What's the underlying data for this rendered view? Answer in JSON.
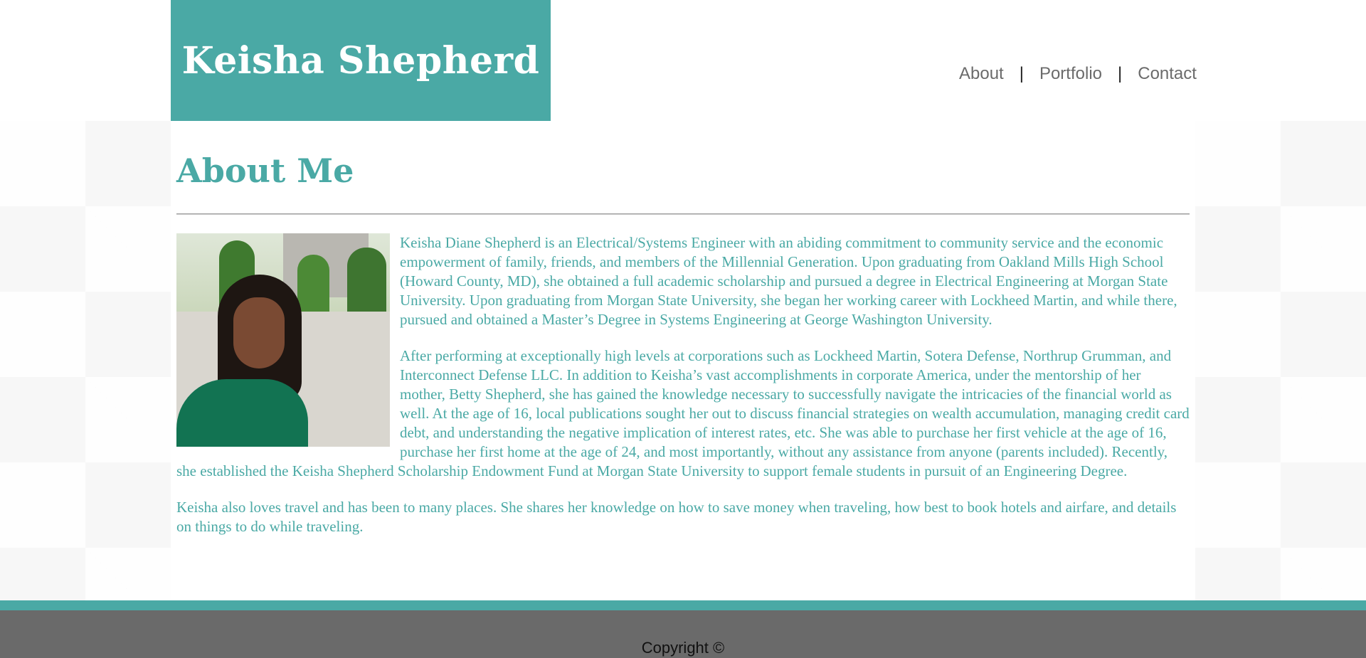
{
  "header": {
    "site_title": "Keisha Shepherd",
    "nav": {
      "about": "About",
      "portfolio": "Portfolio",
      "contact": "Contact",
      "separator": "|"
    }
  },
  "main": {
    "heading": "About Me",
    "paragraphs": [
      "Keisha Diane Shepherd is an Electrical/Systems Engineer with an abiding commitment to community service and the economic empowerment of family, friends, and members of the Millennial Generation. Upon graduating from Oakland Mills High School (Howard County, MD), she obtained a full academic scholarship and pursued a degree in Electrical Engineering at Morgan State University. Upon graduating from Morgan State University, she began her working career with Lockheed Martin, and while there, pursued and obtained a Master’s Degree in Systems Engineering at George Washington University.",
      "After performing at exceptionally high levels at corporations such as Lockheed Martin, Sotera Defense, Northrup Grumman, and Interconnect Defense LLC. In addition to Keisha’s vast accomplishments in corporate America, under the mentorship of her mother, Betty Shepherd, she has gained the knowledge necessary to successfully navigate the intricacies of the financial world as well. At the age of 16, local publications sought her out to discuss financial strategies on wealth accumulation, managing credit card debt, and understanding the negative implication of interest rates, etc. She was able to purchase her first vehicle at the age of 16, purchase her first home at the age of 24, and most importantly, without any assistance from anyone (parents included). Recently, she established the Keisha Shepherd Scholarship Endowment Fund at Morgan State University to support female students in pursuit of an Engineering Degree.",
      "Keisha also loves travel and has been to many places. She shares her knowledge on how to save money when traveling, how best to book hotels and airfare, and details on things to do while traveling."
    ]
  },
  "footer": {
    "copyright": "Copyright ©"
  },
  "colors": {
    "accent": "#4aa9a5",
    "footer_bg": "#6a6a6a",
    "nav_text": "#6b6b6b"
  }
}
